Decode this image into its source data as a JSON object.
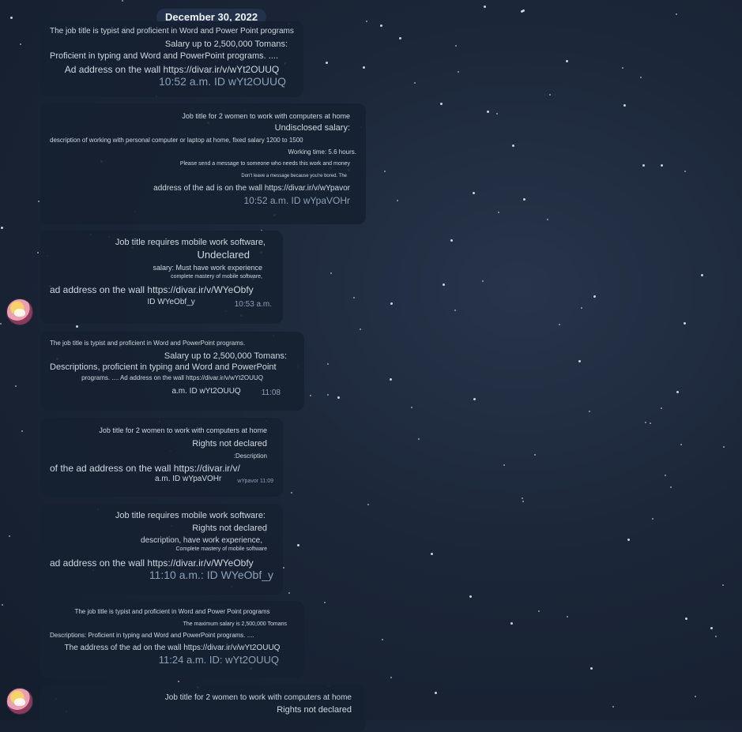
{
  "date_header": "December 30, 2022",
  "messages": [
    {
      "lines": [
        "The job title is typist and proficient in Word and Power Point programs",
        "Salary up to 2,500,000 Tomans:",
        "Proficient in typing and Word and PowerPoint programs. ....",
        "Ad address on the wall https://divar.ir/v/wYt2OUUQ",
        "10:52 a.m. ID wYt2OUUQ"
      ]
    },
    {
      "lines": [
        "Job title for 2 women to work with computers at home",
        "Undisclosed salary:",
        "description of working with personal computer or laptop at home, fixed salary 1200 to 1500",
        "Working time: 5.6 hours.",
        "Please send a message to someone who needs this work and money",
        "Don't leave a message because you're bored. The",
        "address of the ad is on the wall https://divar.ir/v/wYpavor",
        "10:52 a.m. ID wYpaVOHr"
      ]
    },
    {
      "lines": [
        "Job title requires mobile work software,",
        "Undeclared",
        "salary: Must have work experience",
        "complete mastery of mobile software,",
        "ad address on the wall https://divar.ir/v/WYeObfy",
        "ID WYeObf_y",
        "10:53 a.m."
      ]
    },
    {
      "lines": [
        "The job title is typist and proficient in Word and PowerPoint programs.",
        "Salary up to 2,500,000 Tomans:",
        "Descriptions, proficient in typing and Word and PowerPoint",
        "programs. .... Ad address on the wall https://divar.ir/v/wYt2OUUQ",
        "a.m. ID wYt2OUUQ",
        "11:08"
      ]
    },
    {
      "lines": [
        "Job title for 2 women to work with computers at home",
        "Rights not declared",
        ":Description",
        "of the ad address on the wall https://divar.ir/v/",
        "a.m. ID wYpaVOHr",
        "wYpavor 11:09"
      ]
    },
    {
      "lines": [
        "Job title requires mobile work software:",
        "Rights not declared",
        "description, have work experience,",
        "Complete mastery of mobile software",
        "ad address on the wall https://divar.ir/v/WYeObfy",
        "11:10 a.m.: ID WYeObf_y"
      ]
    },
    {
      "lines": [
        "The job title is typist and proficient in Word and Power Point programs",
        "The maximum salary is 2,500,000 Tomans",
        "Descriptions: Proficient in typing and Word and PowerPoint programs. ....",
        "The address of the ad on the wall https://divar.ir/v/wYt2OUUQ",
        "11:24 a.m. ID: wYt2OUUQ"
      ]
    },
    {
      "lines": [
        "Job title for 2 women to work with computers at home",
        "Rights not declared"
      ]
    }
  ]
}
